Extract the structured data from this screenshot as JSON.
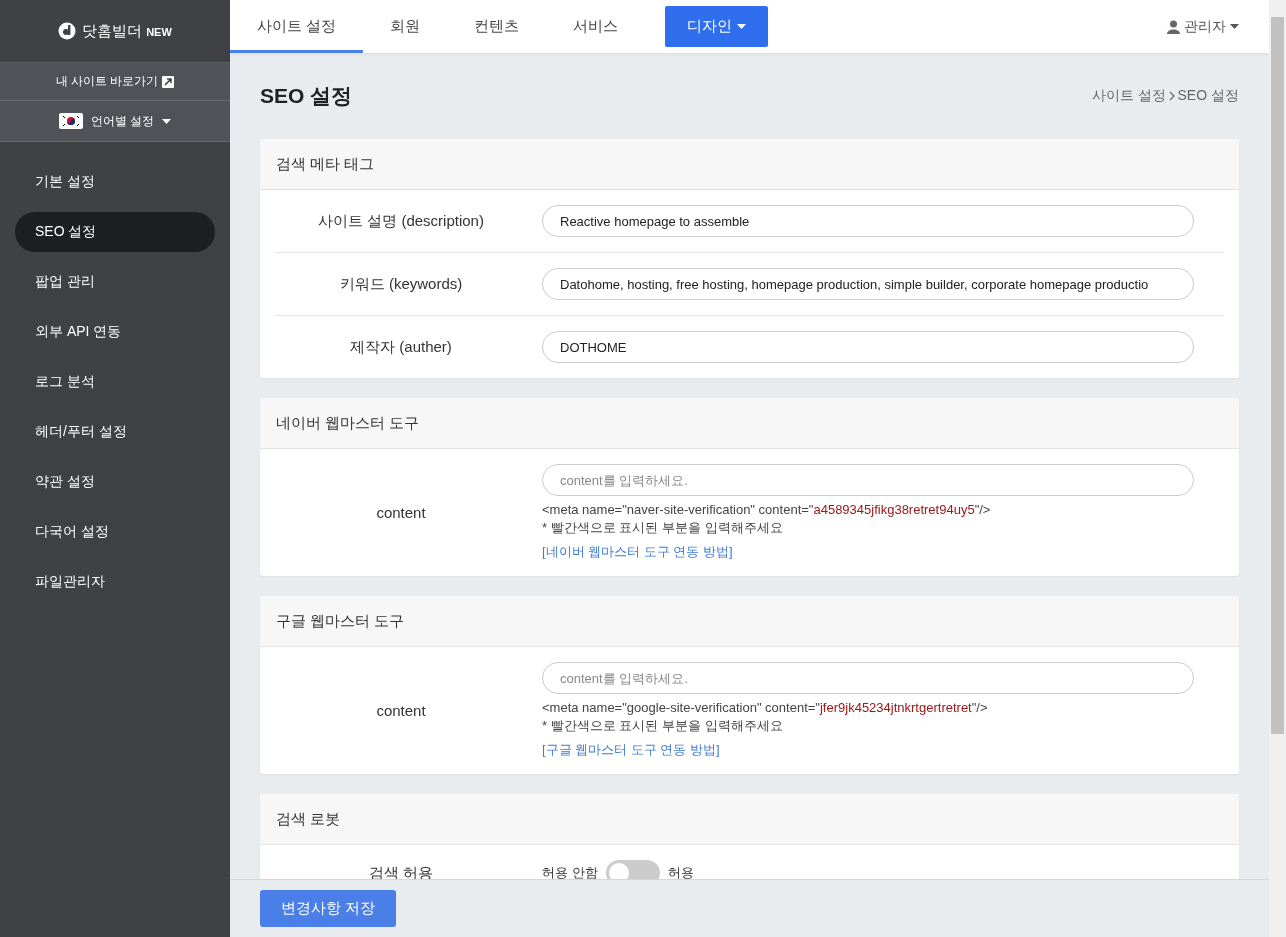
{
  "sidebar": {
    "logo": {
      "text": "닷홈빌더",
      "badge": "NEW"
    },
    "shortcut": "내 사이트 바로가기",
    "language": "언어별 설정",
    "items": [
      {
        "label": "기본 설정",
        "selected": false
      },
      {
        "label": "SEO 설정",
        "selected": true
      },
      {
        "label": "팝업 관리",
        "selected": false
      },
      {
        "label": "외부 API 연동",
        "selected": false
      },
      {
        "label": "로그 분석",
        "selected": false
      },
      {
        "label": "헤더/푸터 설정",
        "selected": false
      },
      {
        "label": "약관 설정",
        "selected": false
      },
      {
        "label": "다국어 설정",
        "selected": false
      },
      {
        "label": "파일관리자",
        "selected": false
      }
    ]
  },
  "top_nav": {
    "tabs": [
      {
        "label": "사이트 설정",
        "kind": "tab",
        "selected": true
      },
      {
        "label": "회원",
        "kind": "tab",
        "selected": false
      },
      {
        "label": "컨텐츠",
        "kind": "tab",
        "selected": false
      },
      {
        "label": "서비스",
        "kind": "tab",
        "selected": false
      },
      {
        "label": "디자인",
        "kind": "dropdown",
        "selected": false
      }
    ],
    "user": "관리자"
  },
  "page": {
    "title": "SEO 설정",
    "breadcrumb": [
      "사이트 설정",
      "SEO 설정"
    ]
  },
  "cards": [
    {
      "title": "검색 메타 태그",
      "rows": [
        {
          "kind": "input",
          "label": "사이트 설명 (description)",
          "value": "Reactive homepage to assemble"
        },
        {
          "kind": "input",
          "label": "키워드 (keywords)",
          "value": "Datohome, hosting, free hosting, homepage production, simple builder, corporate homepage productio"
        },
        {
          "kind": "input",
          "label": "제작자 (auther)",
          "value": "DOTHOME"
        }
      ]
    },
    {
      "title": "네이버 웹마스터 도구",
      "rows": [
        {
          "kind": "verify",
          "label": "content",
          "placeholder": "content를 입력하세요.",
          "hint_prefix": "<meta name=\"naver-site-verification\" content=\"",
          "hint_code": "a4589345jfikg38retret94uy5",
          "hint_suffix": "\"/>",
          "note": "* 빨간색으로 표시된 부분을 입력해주세요",
          "link": "[네이버 웹마스터 도구 연동 방법]"
        }
      ]
    },
    {
      "title": "구글 웹마스터 도구",
      "rows": [
        {
          "kind": "verify",
          "label": "content",
          "placeholder": "content를 입력하세요.",
          "hint_prefix": "<meta name=\"google-site-verification\" content=\"",
          "hint_code": "jfer9jk45234jtnkrtgertretret",
          "hint_suffix": "\"/>",
          "note": "* 빨간색으로 표시된 부분을 입력해주세요",
          "link": "[구글 웹마스터 도구 연동 방법]"
        }
      ]
    },
    {
      "title": "검색 로봇",
      "rows": [
        {
          "kind": "toggle",
          "label": "검색 허용",
          "off_label": "허용 안함",
          "on_label": "허용",
          "on": false
        }
      ]
    }
  ],
  "footer": {
    "save_button": "변경사항 저장"
  }
}
